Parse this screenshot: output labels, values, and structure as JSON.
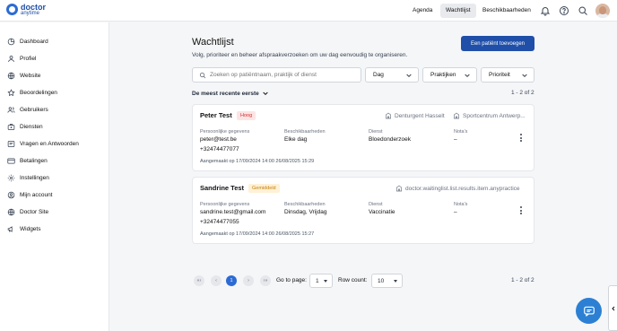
{
  "brand": {
    "name": "doctor",
    "tagline": "anytime",
    "color": "#1f4fa8"
  },
  "topnav": {
    "items": [
      {
        "label": "Agenda",
        "active": false
      },
      {
        "label": "Wachtlijst",
        "active": true
      },
      {
        "label": "Beschikbaarheden",
        "active": false
      }
    ],
    "icons": [
      "bell-icon",
      "help-icon",
      "search-icon"
    ]
  },
  "sidebar": {
    "items": [
      {
        "label": "Dashboard",
        "icon": "dashboard-icon"
      },
      {
        "label": "Profiel",
        "icon": "user-icon"
      },
      {
        "label": "Website",
        "icon": "globe-icon"
      },
      {
        "label": "Beoordelingen",
        "icon": "star-icon"
      },
      {
        "label": "Gebruikers",
        "icon": "users-icon"
      },
      {
        "label": "Diensten",
        "icon": "services-icon"
      },
      {
        "label": "Vragen en Antwoorden",
        "icon": "qa-icon"
      },
      {
        "label": "Betalingen",
        "icon": "card-icon"
      },
      {
        "label": "Instellingen",
        "icon": "gear-icon"
      },
      {
        "label": "Mijn account",
        "icon": "account-icon"
      },
      {
        "label": "Doctor Site",
        "icon": "globe-icon"
      },
      {
        "label": "Widgets",
        "icon": "megaphone-icon"
      }
    ]
  },
  "page": {
    "title": "Wachtlijst",
    "subtitle": "Volg, prioriteer en beheer afspraakverzoeken om uw dag eenvoudig te organiseren.",
    "add_button": "Een patiënt toevoegen"
  },
  "filters": {
    "search_placeholder": "Zoeken op patiëntnaam, praktijk of dienst",
    "day": "Dag",
    "practices": "Praktijken",
    "priority": "Prioriteit"
  },
  "sort": {
    "label": "De meest recente eerste"
  },
  "count": "1 - 2 of 2",
  "cards": [
    {
      "name": "Peter Test",
      "badge": "Hoog",
      "locations": [
        "Denturgent Hasselt",
        "Sportcentrum Antwerp..."
      ],
      "labels": {
        "personal": "Persoonlijke gegevens",
        "availability": "Beschikbaarheden",
        "service": "Dienst",
        "notes": "Nota's"
      },
      "email": "peter@test.be",
      "phone": "+32474477077",
      "availability": "Elke dag",
      "service": "Bloedonderzoek",
      "notes": "–",
      "created": "Aangemaakt op 17/09/2024 14:00 26/08/2025 15:29"
    },
    {
      "name": "Sandrine Test",
      "badge": "Gemiddeld",
      "locations": [
        "doctor.waitinglist.list.results.item.anypractice"
      ],
      "labels": {
        "personal": "Persoonlijke gegevens",
        "availability": "Beschikbaarheden",
        "service": "Dienst",
        "notes": "Nota's"
      },
      "email": "sandrine.test@gmail.com",
      "phone": "+32474477055",
      "availability": "Dinsdag, Vrijdag",
      "service": "Vaccinatie",
      "notes": "–",
      "created": "Aangemaakt op 17/09/2024 14:00 26/08/2025 15:27"
    }
  ],
  "pagination": {
    "first": "«‹",
    "prev": "‹",
    "current": "1",
    "next": "›",
    "last": "›»",
    "goto_label": "Go to page:",
    "goto_value": "1",
    "rowcount_label": "Row count:",
    "rowcount_value": "10"
  },
  "colors": {
    "primary": "#1f4fa8",
    "accent": "#2c6bd4",
    "high": "#d12e2e",
    "medium": "#c4800f"
  }
}
